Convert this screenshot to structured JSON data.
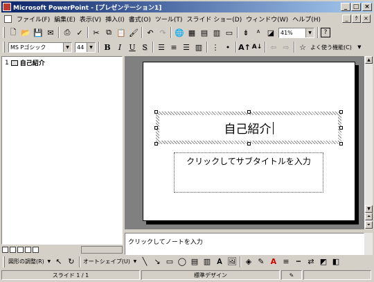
{
  "window": {
    "title": "Microsoft PowerPoint - [プレゼンテーション1]",
    "controls": [
      "_",
      "□",
      "×"
    ],
    "doc_controls": [
      "_",
      "ｸ",
      "×"
    ]
  },
  "menu": [
    "ファイル(F)",
    "編集(E)",
    "表示(V)",
    "挿入(I)",
    "書式(O)",
    "ツール(T)",
    "スライド ショー(D)",
    "ウィンドウ(W)",
    "ヘルプ(H)"
  ],
  "standard_toolbar": {
    "zoom": "41%",
    "help_glyph": "?"
  },
  "format_toolbar": {
    "font": "MS Pゴシック",
    "size": "44",
    "bold": "B",
    "italic": "I",
    "underline": "U",
    "shadow": "S",
    "common_tasks": "よく使う機能(C)"
  },
  "outline": {
    "slide_number": "1",
    "slide_title": "自己紹介"
  },
  "slide": {
    "title": "自己紹介",
    "subtitle_placeholder": "クリックしてサブタイトルを入力"
  },
  "notes": {
    "placeholder": "クリックしてノートを入力"
  },
  "drawing_toolbar": {
    "draw": "図形の調整(R)",
    "autoshape": "オートシェイプ(U)"
  },
  "status": {
    "slide": "スライド 1 / 1",
    "design": "標準デザイン"
  }
}
